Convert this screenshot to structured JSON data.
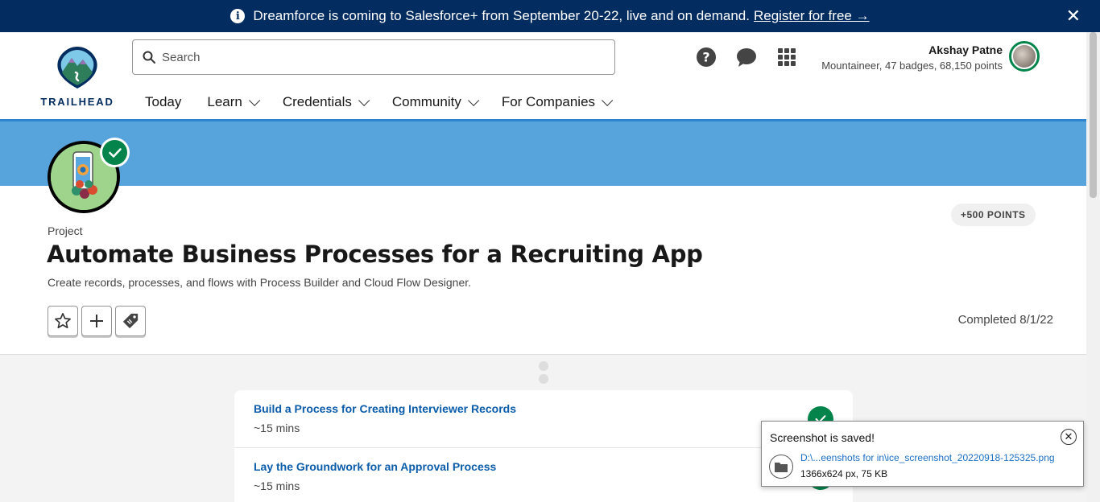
{
  "banner": {
    "message": "Dreamforce is coming to Salesforce+ from September 20-22, live and on demand.",
    "link": "Register for free →",
    "close": "✕"
  },
  "logo": {
    "text": "TRAILHEAD"
  },
  "search": {
    "placeholder": "Search",
    "value": ""
  },
  "user": {
    "name": "Akshay Patne",
    "meta": "Mountaineer, 47 badges, 68,150 points"
  },
  "nav": {
    "items": [
      {
        "label": "Today"
      },
      {
        "label": "Learn"
      },
      {
        "label": "Credentials"
      },
      {
        "label": "Community"
      },
      {
        "label": "For Companies"
      }
    ]
  },
  "project": {
    "type_label": "Project",
    "title": "Automate Business Processes for a Recruiting App",
    "description": "Create records, processes, and flows with Process Builder and Cloud Flow Designer.",
    "points": "+500 POINTS",
    "completed": "Completed 8/1/22"
  },
  "steps": [
    {
      "name": "Build a Process for Creating Interviewer Records",
      "duration": "~15 mins"
    },
    {
      "name": "Lay the Groundwork for an Approval Process",
      "duration": "~15 mins"
    }
  ],
  "toast": {
    "title": "Screenshot is saved!",
    "path": "D:\\...eenshots for in\\ice_screenshot_20220918-125325.png",
    "size": "1366x624 px, 75 KB"
  },
  "colors": {
    "banner_bg": "#032d60",
    "hero_band": "#57a3db",
    "success_green": "#04844b",
    "link_blue": "#0b5cab"
  }
}
